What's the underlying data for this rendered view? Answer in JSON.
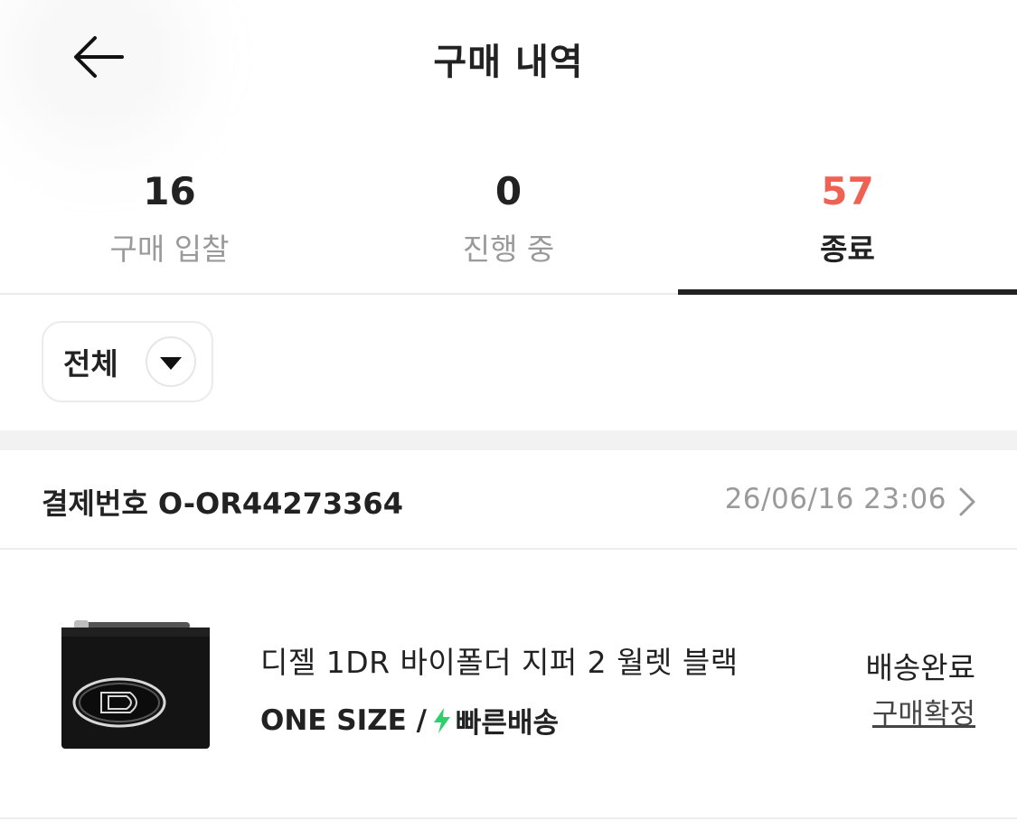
{
  "header": {
    "title": "구매 내역",
    "back_icon": "arrow-left-icon"
  },
  "summary_tabs": [
    {
      "count": "16",
      "label": "구매 입찰",
      "active": false
    },
    {
      "count": "0",
      "label": "진행 중",
      "active": false
    },
    {
      "count": "57",
      "label": "종료",
      "active": true
    }
  ],
  "colors": {
    "active_count": "#ef6253",
    "text": "#222222",
    "muted": "#9a9a9a",
    "bolt": "#2fd06b"
  },
  "filter": {
    "label": "전체",
    "icon": "triangle-down-icon"
  },
  "order": {
    "id_label": "결제번호",
    "id_value": "O-OR44273364",
    "date": "26/06/16 23:06",
    "chevron_icon": "chevron-right-icon"
  },
  "product": {
    "name": "디젤 1DR 바이폴더 지퍼 2 월렛 블랙",
    "size": "ONE SIZE /",
    "delivery_icon": "lightning-icon",
    "delivery": "빠른배송",
    "status": "배송완료",
    "action": "구매확정"
  }
}
